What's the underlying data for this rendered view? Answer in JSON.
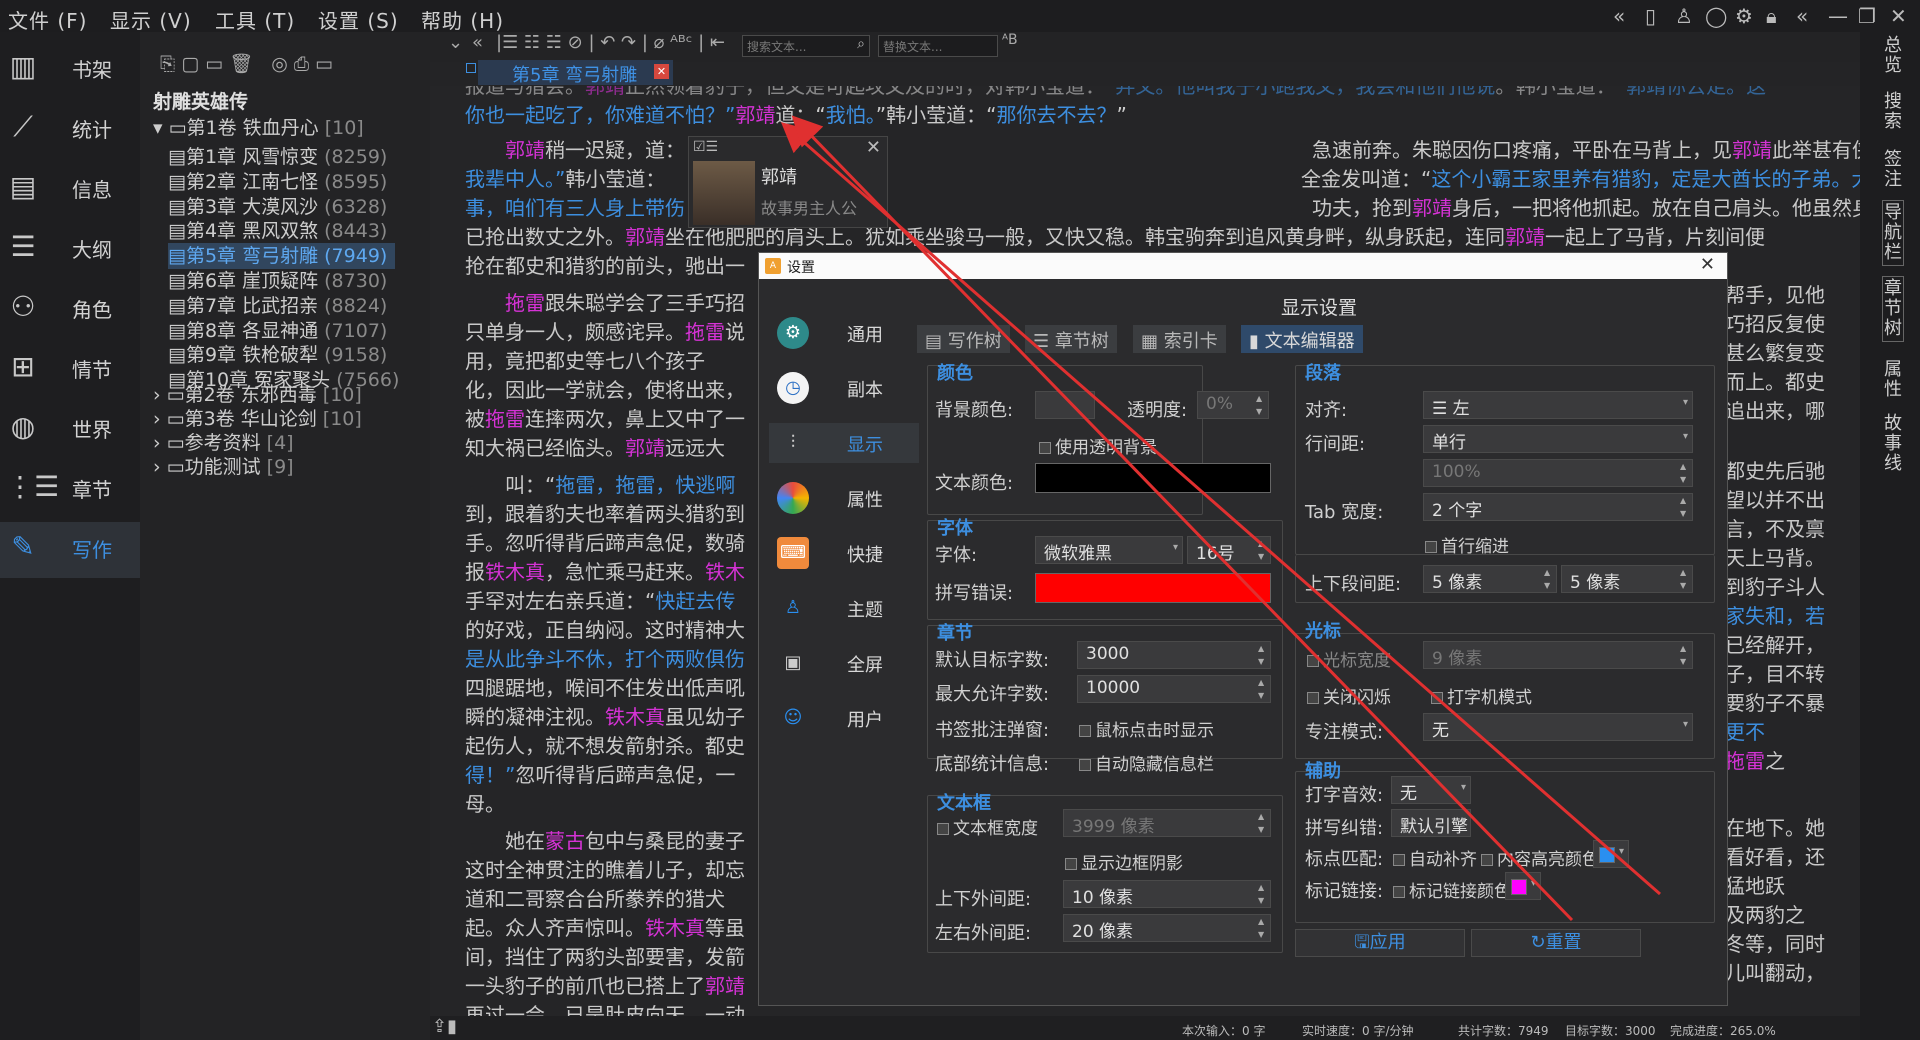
{
  "menu": [
    "文件 (F)",
    "显示 (V)",
    "工具 (T)",
    "设置 (S)",
    "帮助 (H)"
  ],
  "leftnav": [
    {
      "icon": "bookshelf-icon",
      "label": "书架"
    },
    {
      "icon": "stats-icon",
      "label": "统计"
    },
    {
      "icon": "info-icon",
      "label": "信息"
    },
    {
      "icon": "outline-icon",
      "label": "大纲"
    },
    {
      "icon": "characters-icon",
      "label": "角色"
    },
    {
      "icon": "plot-icon",
      "label": "情节"
    },
    {
      "icon": "world-icon",
      "label": "世界"
    },
    {
      "icon": "chapters-icon",
      "label": "章节"
    },
    {
      "icon": "write-icon",
      "label": "写作"
    }
  ],
  "tree": {
    "book": "射雕英雄传",
    "volume1": {
      "label": "第1卷 铁血丹心",
      "count": "[10]"
    },
    "chapters": [
      {
        "label": "第1章 风雪惊变",
        "count": "(8259)"
      },
      {
        "label": "第2章 江南七怪",
        "count": "(8595)"
      },
      {
        "label": "第3章 大漠风沙",
        "count": "(6328)"
      },
      {
        "label": "第4章 黑风双煞",
        "count": "(8443)"
      },
      {
        "label": "第5章 弯弓射雕",
        "count": "(7949)"
      },
      {
        "label": "第6章 崖顶疑阵",
        "count": "(8730)"
      },
      {
        "label": "第7章 比武招亲",
        "count": "(8824)"
      },
      {
        "label": "第8章 各显神通",
        "count": "(7107)"
      },
      {
        "label": "第9章 铁枪破犁",
        "count": "(9158)"
      },
      {
        "label": "第10章 冤家聚头",
        "count": "(7566)"
      }
    ],
    "others": [
      {
        "label": "第2卷 东邪西毒",
        "count": "[10]"
      },
      {
        "label": "第3卷 华山论剑",
        "count": "[10]"
      },
      {
        "label": "参考资料",
        "count": "[4]"
      },
      {
        "label": "功能测试",
        "count": "[9]"
      }
    ]
  },
  "toolbar": {
    "search_placeholder": "搜索文本...",
    "replace_placeholder": "替换文本..."
  },
  "tab": {
    "title": "第5章 弯弓射雕"
  },
  "popup": {
    "name": "郭靖",
    "desc": "故事男主人公"
  },
  "rightbar": [
    "总览",
    "搜索",
    "签注",
    "导航栏",
    "章节树",
    "属性",
    "故事线"
  ],
  "status": {
    "input": "本次输入：0 字",
    "speed": "实时速度：0 字/分钟",
    "total": "共计字数：7949",
    "target": "目标字数：3000",
    "progress": "完成进度：265.0%"
  },
  "dialog": {
    "title": "设置",
    "heading": "显示设置",
    "nav": [
      {
        "icon": "gear-icon",
        "label": "通用"
      },
      {
        "icon": "clock-icon",
        "label": "副本"
      },
      {
        "icon": "sliders-icon",
        "label": "显示"
      },
      {
        "icon": "palette-icon",
        "label": "属性"
      },
      {
        "icon": "keyboard-icon",
        "label": "快捷"
      },
      {
        "icon": "shirt-icon",
        "label": "主题"
      },
      {
        "icon": "fullscreen-icon",
        "label": "全屏"
      },
      {
        "icon": "user-icon",
        "label": "用户"
      }
    ],
    "tabs": [
      "写作树",
      "章节树",
      "索引卡",
      "文本编辑器"
    ],
    "color": {
      "title": "颜色",
      "bg_label": "背景颜色:",
      "opacity_label": "透明度:",
      "opacity": "0%",
      "transparent": "使用透明背景",
      "text_label": "文本颜色:",
      "text_color": "#000000"
    },
    "font": {
      "title": "字体",
      "font_label": "字体:",
      "font": "微软雅黑",
      "size": "16号",
      "spell_label": "拼写错误:",
      "spell_color": "#ff0000"
    },
    "chapter": {
      "title": "章节",
      "target_label": "默认目标字数:",
      "target": "3000",
      "max_label": "最大允许字数:",
      "max": "10000",
      "popup_label": "书签批注弹窗:",
      "popup_opt": "鼠标点击时显示",
      "stats_label": "底部统计信息:",
      "stats_opt": "自动隐藏信息栏"
    },
    "textbox": {
      "title": "文本框",
      "width_opt": "文本框宽度",
      "width": "3999 像素",
      "shadow": "显示边框阴影",
      "vmargin_label": "上下外间距:",
      "vmargin": "10 像素",
      "hmargin_label": "左右外间距:",
      "hmargin": "20 像素"
    },
    "paragraph": {
      "title": "段落",
      "align_label": "对齐:",
      "align": "左",
      "spacing_label": "行间距:",
      "spacing": "单行",
      "spacing_pct": "100%",
      "tab_label": "Tab 宽度:",
      "tab": "2 个字",
      "indent": "首行缩进",
      "para_label": "上下段间距:",
      "para_top": "5 像素",
      "para_bottom": "5 像素"
    },
    "cursor": {
      "title": "光标",
      "width_opt": "光标宽度",
      "width": "9 像素",
      "no_blink": "关闭闪烁",
      "typewriter": "打字机模式",
      "focus_label": "专注模式:",
      "focus": "无"
    },
    "assist": {
      "title": "辅助",
      "sound_label": "打字音效:",
      "sound": "无",
      "spell_label": "拼写纠错:",
      "spell": "默认引擎",
      "punct_label": "标点匹配:",
      "autocomplete": "自动补齐",
      "highlight": "内容高亮颜色",
      "highlight_color": "#2a8ff0",
      "link_label": "标记链接:",
      "link_opt": "标记链接颜色",
      "link_color": "#ff00ff"
    },
    "apply": "应用",
    "reset": "重置"
  }
}
